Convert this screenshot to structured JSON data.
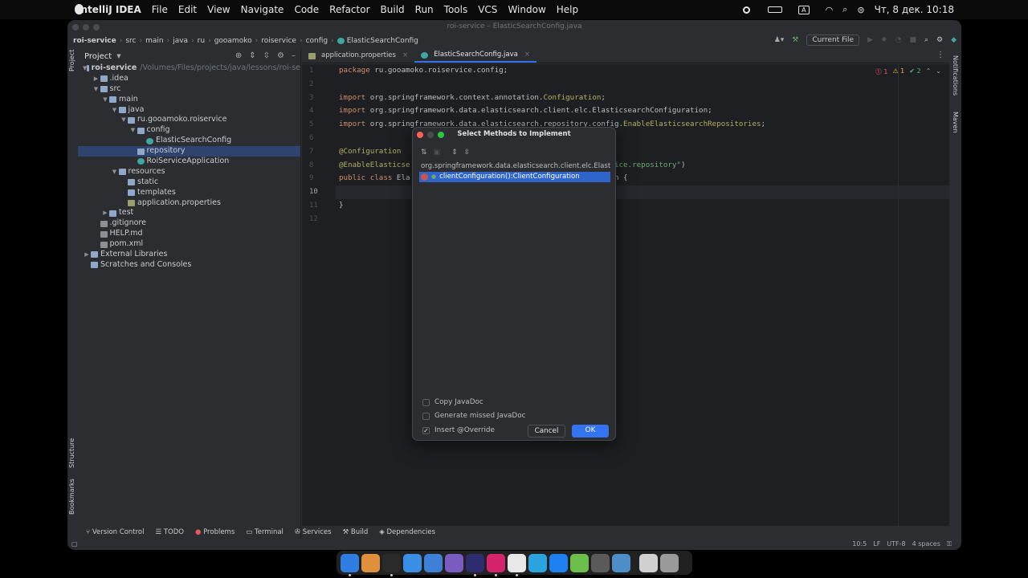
{
  "menubar": {
    "items": [
      "IntelliJ IDEA",
      "File",
      "Edit",
      "View",
      "Navigate",
      "Code",
      "Refactor",
      "Build",
      "Run",
      "Tools",
      "VCS",
      "Window",
      "Help"
    ],
    "input_source": "A",
    "clock": "Чт, 8 дек.  10:18"
  },
  "window": {
    "title": "roi-service – ElasticSearchConfig.java"
  },
  "navbar": {
    "crumbs": [
      "roi-service",
      "src",
      "main",
      "java",
      "ru",
      "gooamoko",
      "roiservice",
      "config",
      "ElasticSearchConfig"
    ],
    "run_config": "Current File"
  },
  "project": {
    "title": "Project",
    "tree": [
      {
        "label": "roi-service",
        "extra": "/Volumes/Files/projects/java/lessons/roi-se",
        "indent": 0,
        "arrow": "v",
        "icon": "folder"
      },
      {
        "label": ".idea",
        "indent": 1,
        "arrow": ">",
        "icon": "folder"
      },
      {
        "label": "src",
        "indent": 1,
        "arrow": "v",
        "icon": "folder"
      },
      {
        "label": "main",
        "indent": 2,
        "arrow": "v",
        "icon": "folder"
      },
      {
        "label": "java",
        "indent": 3,
        "arrow": "v",
        "icon": "folder"
      },
      {
        "label": "ru.gooamoko.roiservice",
        "indent": 4,
        "arrow": "v",
        "icon": "folder"
      },
      {
        "label": "config",
        "indent": 5,
        "arrow": "v",
        "icon": "folder"
      },
      {
        "label": "ElasticSearchConfig",
        "indent": 6,
        "arrow": "",
        "icon": "javafile"
      },
      {
        "label": "repository",
        "indent": 5,
        "arrow": "",
        "icon": "folder",
        "selected": true
      },
      {
        "label": "RoiServiceApplication",
        "indent": 5,
        "arrow": "",
        "icon": "javafile"
      },
      {
        "label": "resources",
        "indent": 3,
        "arrow": "v",
        "icon": "folder"
      },
      {
        "label": "static",
        "indent": 4,
        "arrow": "",
        "icon": "folder"
      },
      {
        "label": "templates",
        "indent": 4,
        "arrow": "",
        "icon": "folder"
      },
      {
        "label": "application.properties",
        "indent": 4,
        "arrow": "",
        "icon": "propfile"
      },
      {
        "label": "test",
        "indent": 2,
        "arrow": ">",
        "icon": "folder"
      },
      {
        "label": ".gitignore",
        "indent": 1,
        "arrow": "",
        "icon": "txtfile"
      },
      {
        "label": "HELP.md",
        "indent": 1,
        "arrow": "",
        "icon": "txtfile"
      },
      {
        "label": "pom.xml",
        "indent": 1,
        "arrow": "",
        "icon": "txtfile"
      },
      {
        "label": "External Libraries",
        "indent": 0,
        "arrow": ">",
        "icon": "folder"
      },
      {
        "label": "Scratches and Consoles",
        "indent": 0,
        "arrow": "",
        "icon": "folder"
      }
    ]
  },
  "tabs": [
    {
      "label": "application.properties",
      "active": false
    },
    {
      "label": "ElasticSearchConfig.java",
      "active": true
    }
  ],
  "editor": {
    "line_numbers": [
      "1",
      "2",
      "3",
      "4",
      "5",
      "6",
      "7",
      "8",
      "9",
      "10",
      "11",
      "12"
    ],
    "current_line": "10",
    "lines": [
      [
        {
          "t": "package ",
          "c": "kw"
        },
        {
          "t": "ru.gooamoko.roiservice.config;",
          "c": ""
        }
      ],
      [],
      [
        {
          "t": "import ",
          "c": "kw"
        },
        {
          "t": "org.springframework.context.annotation.",
          "c": ""
        },
        {
          "t": "Configuration",
          "c": "ann"
        },
        {
          "t": ";",
          "c": ""
        }
      ],
      [
        {
          "t": "import ",
          "c": "kw"
        },
        {
          "t": "org.springframework.data.elasticsearch.client.elc.ElasticsearchConfiguration;",
          "c": ""
        }
      ],
      [
        {
          "t": "import ",
          "c": "kw"
        },
        {
          "t": "org.springframework.data.elasticsearch.repository.config.",
          "c": ""
        },
        {
          "t": "EnableElasticsearchRepositories",
          "c": "ann"
        },
        {
          "t": ";",
          "c": ""
        }
      ],
      [],
      [
        {
          "t": "@Configuration",
          "c": "ann"
        }
      ],
      [
        {
          "t": "@EnableElasticse",
          "c": "ann"
        },
        {
          "t": "                                      ",
          "c": ""
        },
        {
          "t": ".roiservice.repository\"",
          "c": "str"
        },
        {
          "t": ")",
          "c": ""
        }
      ],
      [
        {
          "t": "public class ",
          "c": "kw"
        },
        {
          "t": "Ela",
          "c": ""
        },
        {
          "t": "                                        uration {",
          "c": ""
        }
      ],
      [],
      [
        {
          "t": "}",
          "c": ""
        }
      ],
      []
    ],
    "inspections": {
      "errors": "1",
      "warnings": "1",
      "ok": "2"
    }
  },
  "right_strip": [
    "Notifications",
    "Maven"
  ],
  "left_strip": [
    "Project",
    "Structure",
    "Bookmarks"
  ],
  "bottom_tools": [
    "Version Control",
    "TODO",
    "Problems",
    "Terminal",
    "Services",
    "Build",
    "Dependencies"
  ],
  "status": {
    "position": "10:5",
    "line_sep": "LF",
    "encoding": "UTF-8",
    "indent": "4 spaces"
  },
  "dialog": {
    "title": "Select Methods to Implement",
    "group": "org.springframework.data.elasticsearch.client.elc.Elast",
    "method": "clientConfiguration():ClientConfiguration",
    "copy_javadoc": "Copy JavaDoc",
    "generate_javadoc": "Generate missed JavaDoc",
    "insert_override": "Insert @Override",
    "cancel": "Cancel",
    "ok": "OK"
  },
  "dock": {
    "colors": [
      "#2f7de1",
      "#e0903c",
      "#2a2a2a",
      "#3b8ee6",
      "#3e7fd8",
      "#7a5cc0",
      "#2c2c6e",
      "#d6246c",
      "#e8e8e8",
      "#2aa3df",
      "#1e7ff0",
      "#6bbf4a",
      "#5a5a5a",
      "#4d8ec9",
      "#d0d0d0",
      "#9a9a9a"
    ],
    "icons": [
      "finder-icon",
      "launchpad-icon",
      "terminal-icon",
      "safari-icon",
      "mail-icon",
      "preview-icon",
      "intellij-icon",
      "intellij-ce-icon",
      "chrome-icon",
      "telegram-icon",
      "appstore-icon",
      "maps-icon",
      "settings-icon",
      "network-icon",
      "document-icon",
      "trash-icon"
    ]
  }
}
